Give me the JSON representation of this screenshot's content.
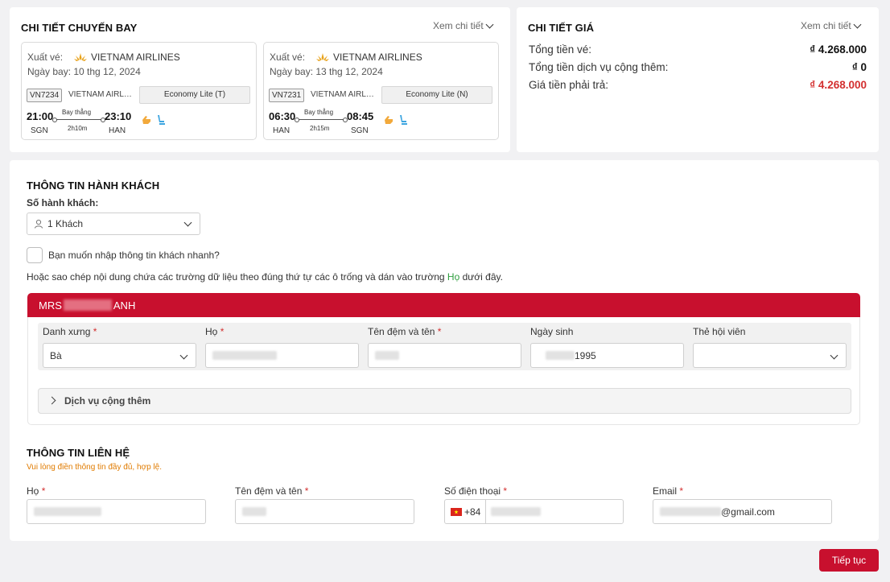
{
  "flight_details": {
    "title": "CHI TIẾT CHUYẾN BAY",
    "more": "Xem chi tiết",
    "flights": [
      {
        "ticket_label": "Xuất vé:",
        "airline": "VIETNAM AIRLINES",
        "date": "Ngày bay: 10 thg 12, 2024",
        "code": "VN7234",
        "aircraft": "VIETNAM AIRLI...",
        "fare": "Economy Lite   (T)",
        "dep_time": "21:00",
        "arr_time": "23:10",
        "dep_airport": "SGN",
        "arr_airport": "HAN",
        "direct": "Bay thẳng",
        "duration": "2h10m"
      },
      {
        "ticket_label": "Xuất vé:",
        "airline": "VIETNAM AIRLINES",
        "date": "Ngày bay: 13 thg 12, 2024",
        "code": "VN7231",
        "aircraft": "VIETNAM AIRLI...",
        "fare": "Economy Lite   (N)",
        "dep_time": "06:30",
        "arr_time": "08:45",
        "dep_airport": "HAN",
        "arr_airport": "SGN",
        "direct": "Bay thẳng",
        "duration": "2h15m"
      }
    ]
  },
  "price_details": {
    "title": "CHI TIẾT GIÁ",
    "more": "Xem chi tiết",
    "rows": [
      {
        "label": "Tổng tiền vé:",
        "value": "₫ 4.268.000"
      },
      {
        "label": "Tổng tiền dịch vụ cộng thêm:",
        "value": "₫ 0"
      },
      {
        "label": "Giá tiền phải trả:",
        "value": "₫ 4.268.000"
      }
    ]
  },
  "passenger": {
    "title": "THÔNG TIN HÀNH KHÁCH",
    "count_label": "Số hành khách:",
    "count_value": "1 Khách",
    "quick_fill": "Bạn muốn nhập thông tin khách nhanh?",
    "hint_prefix": "Hoặc sao chép nội dung chứa các trường dữ liệu theo đúng thứ tự các ô trống và dán vào trường ",
    "hint_link": "Họ",
    "hint_suffix": " dưới đây.",
    "tab_prefix": "MRS",
    "tab_suffix": "ANH",
    "fields": {
      "title_label": "Danh xưng",
      "title_value": "Bà",
      "last_name_label": "Họ",
      "first_name_label": "Tên đệm và tên",
      "dob_label": "Ngày sinh",
      "dob_value": "1995",
      "member_label": "Thẻ hội viên"
    },
    "addon": "Dịch vụ cộng thêm"
  },
  "contact": {
    "title": "THÔNG TIN LIÊN HỆ",
    "note": "Vui lòng điền thông tin đầy đủ, hợp lệ.",
    "last_name_label": "Họ",
    "first_name_label": "Tên đệm và tên",
    "phone_label": "Số điện thoại",
    "phone_prefix": "+84",
    "email_label": "Email",
    "email_suffix": "@gmail.com"
  },
  "next_button": "Tiếp tục",
  "colors": {
    "brand_red": "#c8102e",
    "price_red": "#d32f2f",
    "note_orange": "#e07b00",
    "link_green": "#2e9e3e"
  }
}
